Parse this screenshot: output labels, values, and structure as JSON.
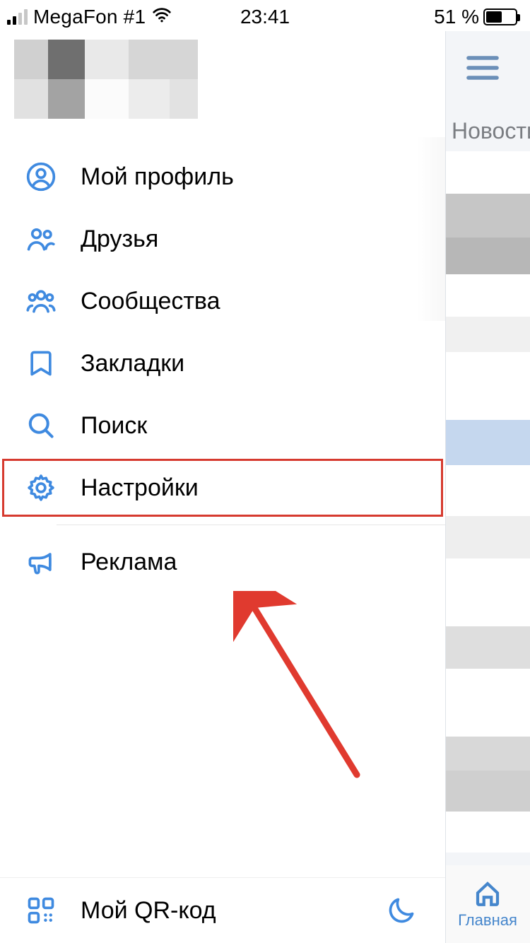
{
  "status_bar": {
    "carrier": "MegaFon #1",
    "time": "23:41",
    "battery_text": "51 %"
  },
  "menu": {
    "items": [
      {
        "label": "Мой профиль"
      },
      {
        "label": "Друзья"
      },
      {
        "label": "Сообщества"
      },
      {
        "label": "Закладки"
      },
      {
        "label": "Поиск"
      },
      {
        "label": "Настройки"
      },
      {
        "label": "Реклама"
      }
    ],
    "qr_label": "Мой QR-код"
  },
  "peek": {
    "title": "Новости",
    "tab_label": "Главная"
  },
  "annotation": {
    "highlighted_item_index": 5
  }
}
